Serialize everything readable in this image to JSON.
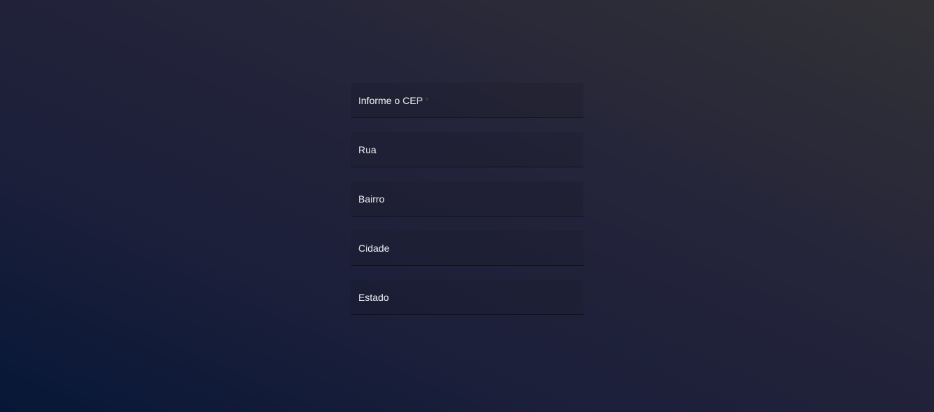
{
  "form": {
    "fields": [
      {
        "label": "Informe o CEP",
        "required_marker": "*",
        "value": ""
      },
      {
        "label": "Rua",
        "value": ""
      },
      {
        "label": "Bairro",
        "value": ""
      },
      {
        "label": "Cidade",
        "value": ""
      },
      {
        "label": "Estado",
        "value": ""
      }
    ]
  },
  "colors": {
    "label_text": "#f2f2f5",
    "underline": "#111118",
    "background_dark": "#071737",
    "background_light": "#323236"
  }
}
